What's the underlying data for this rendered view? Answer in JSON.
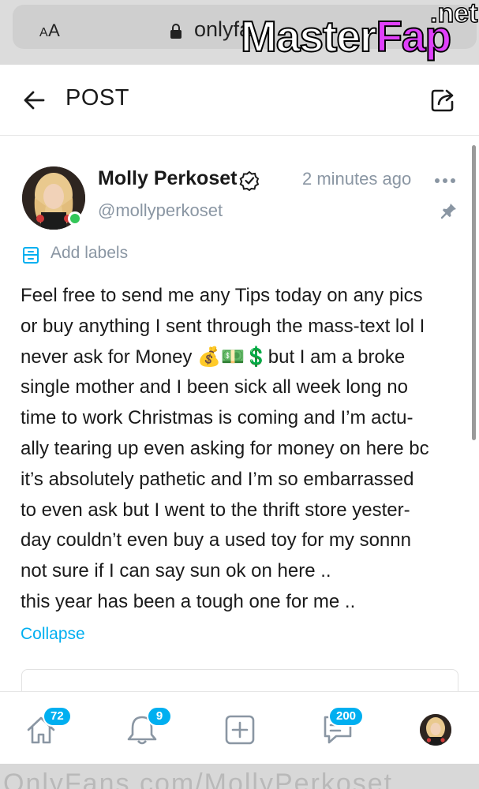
{
  "browser": {
    "aa_label_big": "A",
    "aa_label_small": "A",
    "url": "onlyfa"
  },
  "watermark": {
    "main_white": "Master",
    "main_pink": "Fap",
    "suffix": ".net"
  },
  "topnav": {
    "title": "POST"
  },
  "post": {
    "author_name": "Molly Perkoset",
    "handle": "@mollyperkoset",
    "timestamp": "2 minutes ago",
    "labels_action": "Add labels",
    "lines": [
      "Feel free to send me any Tips today on any pics",
      "or buy anything I sent through the mass-text lol I",
      "never ask for Money 💰💵💲but I am a broke",
      "single mother and I been sick all week long no",
      "time to work Christmas is coming and I’m actu-",
      "ally tearing up even asking for money on here bc",
      "it’s absolutely pathetic and I’m so embarrassed",
      "to even ask but I went to the thrift store yester-",
      "day couldn’t even buy a used toy for my sonnn",
      "not sure if I can say sun ok on here ..",
      "this year has been a tough one for me .."
    ],
    "collapse_label": "Collapse"
  },
  "bottomnav": {
    "home_badge": "72",
    "notifications_badge": "9",
    "messages_badge": "200"
  },
  "bottom_bar": {
    "text": "OnlyFans.com/MollyPerkoset"
  },
  "colors": {
    "accent": "#00aff0",
    "muted": "#8a96a3",
    "online": "#34c759"
  }
}
